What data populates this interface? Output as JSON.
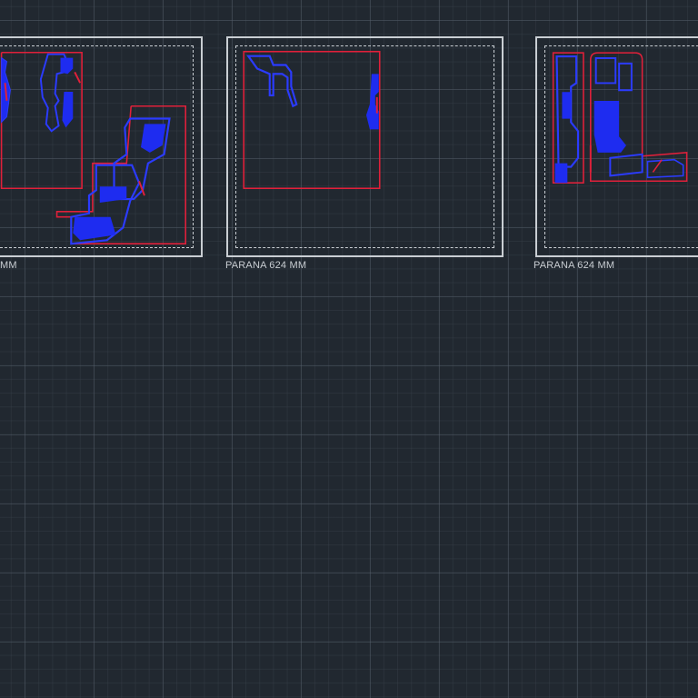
{
  "viewport": {
    "background_color": "#212830",
    "grid_color": "#4a5460"
  },
  "colors": {
    "sheet_border": "#c9ced3",
    "outline_red": "#e0203a",
    "block_blue": "#1e2cf0"
  },
  "sheets": [
    {
      "label": "MM"
    },
    {
      "label": "PARANA 624 MM"
    },
    {
      "label": "PARANA 624 MM"
    }
  ]
}
